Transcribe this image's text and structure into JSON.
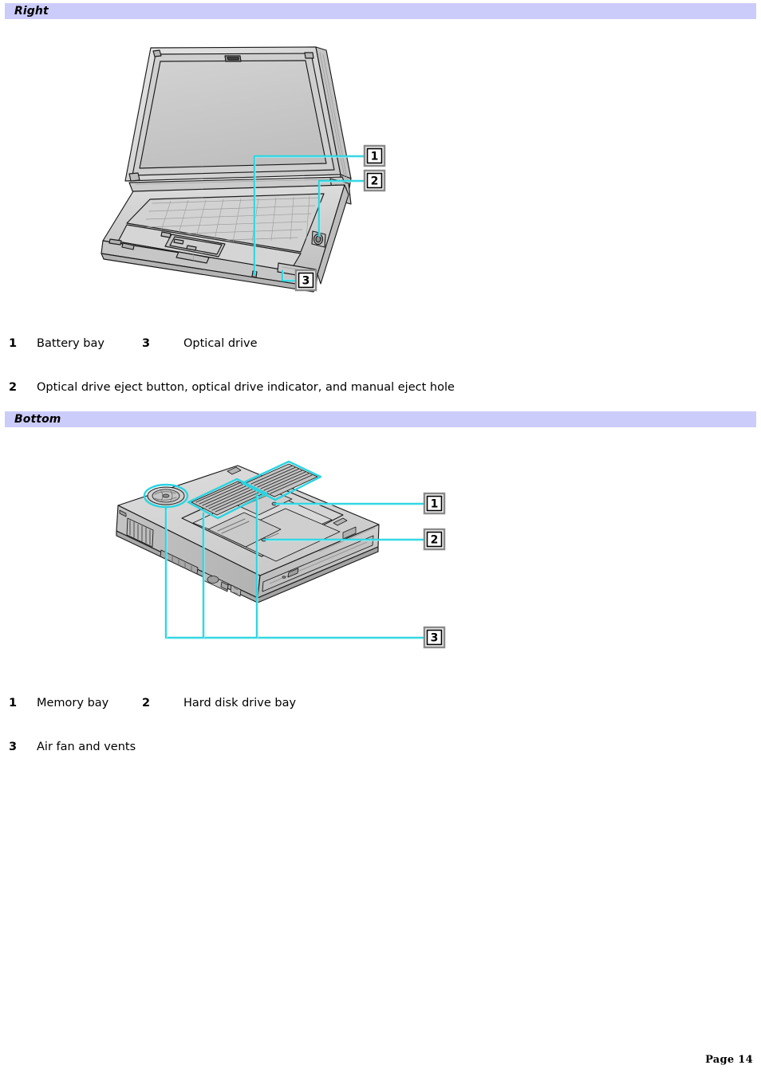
{
  "document": {
    "page_label": "Page 14"
  },
  "sections": [
    {
      "title": "Right",
      "figure": {
        "name": "laptop-right-side-view",
        "callouts": [
          "1",
          "2",
          "3"
        ]
      },
      "legend": [
        {
          "num": "1",
          "text": "Battery bay"
        },
        {
          "num": "3",
          "text": "Optical drive"
        },
        {
          "num": "2",
          "text": "Optical drive eject button, optical drive indicator, and manual eject hole"
        }
      ]
    },
    {
      "title": "Bottom",
      "figure": {
        "name": "laptop-bottom-view",
        "callouts": [
          "1",
          "2",
          "3"
        ]
      },
      "legend": [
        {
          "num": "1",
          "text": "Memory bay"
        },
        {
          "num": "2",
          "text": "Hard disk drive bay"
        },
        {
          "num": "3",
          "text": "Air fan and vents"
        }
      ]
    }
  ],
  "colors": {
    "section_bar": "#ccccfb",
    "callout_line": "#2ad4e0",
    "callout_border_outer": "#8a8a8a",
    "callout_border_inner": "#000000",
    "illustration_fill": "#d7d7d7",
    "illustration_stroke": "#1a1a1a"
  }
}
